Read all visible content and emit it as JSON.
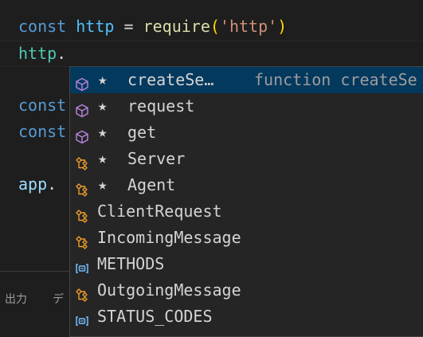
{
  "editor": {
    "line1": {
      "kw": "const",
      "name": "http",
      "eq": "=",
      "fn": "require",
      "open": "(",
      "str": "'http'",
      "close": ")"
    },
    "line2": {
      "obj": "http",
      "dot": "."
    },
    "line3": {
      "kw": "const"
    },
    "line4": {
      "kw": "const"
    },
    "line5": {
      "obj": "app",
      "dot": "."
    }
  },
  "panel": {
    "tabs": [
      {
        "label": "出力"
      },
      {
        "label": "デ"
      }
    ]
  },
  "suggestions": {
    "items": [
      {
        "icon": "method-icon",
        "star": "★",
        "label": "createSe…",
        "detail": "function createSe",
        "selected": true
      },
      {
        "icon": "method-icon",
        "star": "★",
        "label": "request"
      },
      {
        "icon": "method-icon",
        "star": "★",
        "label": "get"
      },
      {
        "icon": "class-icon",
        "star": "★",
        "label": "Server"
      },
      {
        "icon": "class-icon",
        "star": "★",
        "label": "Agent"
      },
      {
        "icon": "class-icon",
        "label": "ClientRequest"
      },
      {
        "icon": "class-icon",
        "label": "IncomingMessage"
      },
      {
        "icon": "enum-icon",
        "label": "METHODS"
      },
      {
        "icon": "class-icon",
        "label": "OutgoingMessage"
      },
      {
        "icon": "enum-icon",
        "label": "STATUS_CODES"
      }
    ]
  },
  "colors": {
    "method": "#b180d7",
    "class": "#ee9d28",
    "enum": "#75beff",
    "selection": "#04395e"
  }
}
